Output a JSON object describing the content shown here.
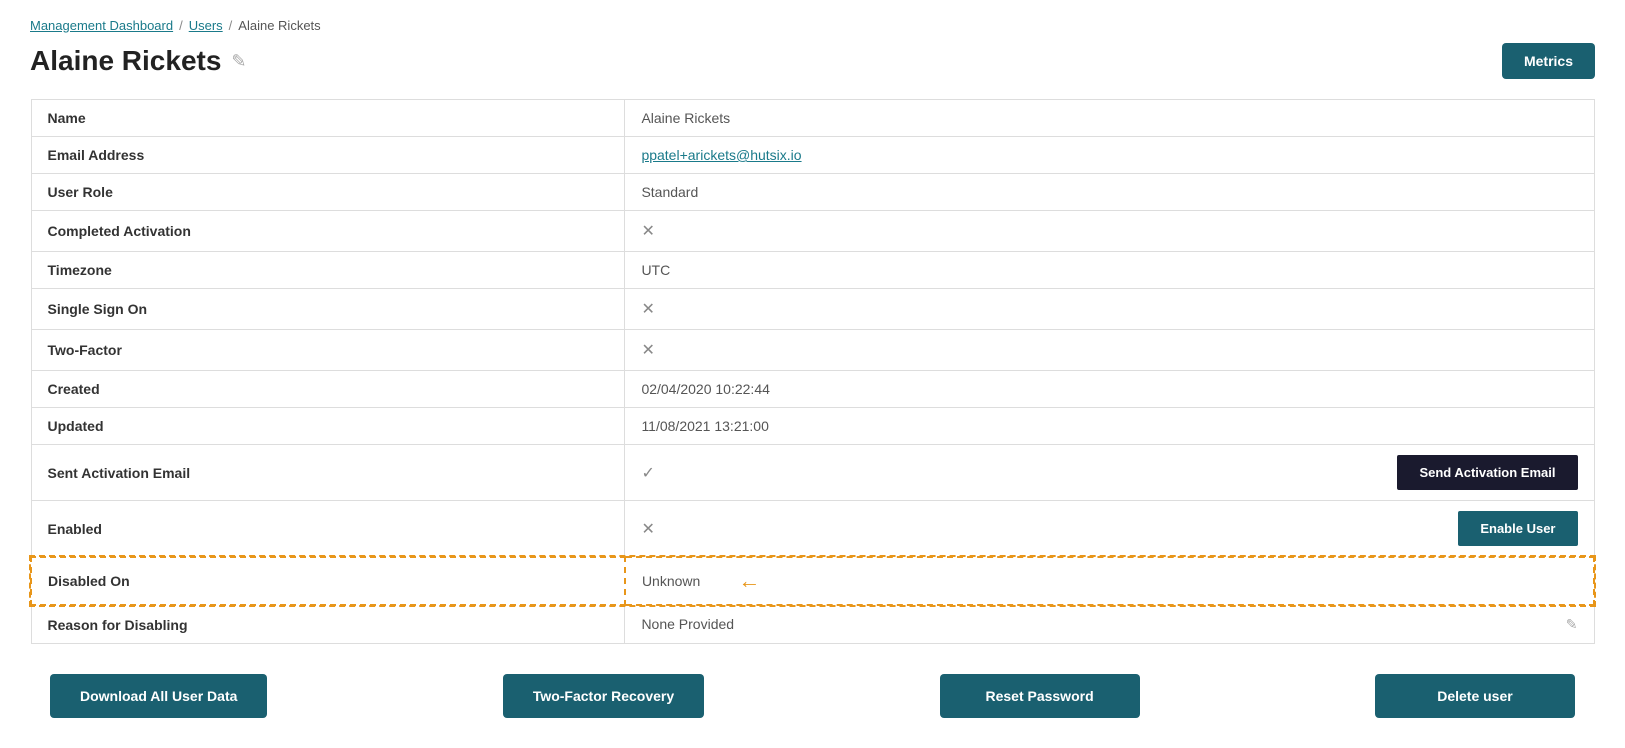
{
  "breadcrumb": {
    "items": [
      {
        "label": "Management Dashboard",
        "link": true
      },
      {
        "label": "Users",
        "link": true
      },
      {
        "label": "Alaine Rickets",
        "link": false
      }
    ],
    "separators": [
      "/",
      "/"
    ]
  },
  "page": {
    "title": "Alaine Rickets",
    "edit_icon": "✎",
    "metrics_btn": "Metrics"
  },
  "user_info": {
    "rows": [
      {
        "label": "Name",
        "value": "Alaine Rickets",
        "type": "text"
      },
      {
        "label": "Email Address",
        "value": "ppatel+arickets@hutsix.io",
        "type": "email"
      },
      {
        "label": "User Role",
        "value": "Standard",
        "type": "text"
      },
      {
        "label": "Completed Activation",
        "value": "✕",
        "type": "icon"
      },
      {
        "label": "Timezone",
        "value": "UTC",
        "type": "text"
      },
      {
        "label": "Single Sign On",
        "value": "✕",
        "type": "icon"
      },
      {
        "label": "Two-Factor",
        "value": "✕",
        "type": "icon"
      },
      {
        "label": "Created",
        "value": "02/04/2020 10:22:44",
        "type": "text"
      },
      {
        "label": "Updated",
        "value": "11/08/2021 13:21:00",
        "type": "text"
      },
      {
        "label": "Sent Activation Email",
        "value": "✓",
        "type": "check",
        "btn": "Send Activation Email",
        "btn_style": "dark"
      },
      {
        "label": "Enabled",
        "value": "✕",
        "type": "icon",
        "btn": "Enable User",
        "btn_style": "teal"
      },
      {
        "label": "Disabled On",
        "value": "Unknown",
        "type": "text",
        "highlight": true
      },
      {
        "label": "Reason for Disabling",
        "value": "None Provided",
        "type": "text",
        "edit_icon": true
      }
    ]
  },
  "actions": {
    "buttons": [
      {
        "label": "Download All User Data"
      },
      {
        "label": "Two-Factor Recovery"
      },
      {
        "label": "Reset Password"
      },
      {
        "label": "Delete user"
      }
    ]
  }
}
